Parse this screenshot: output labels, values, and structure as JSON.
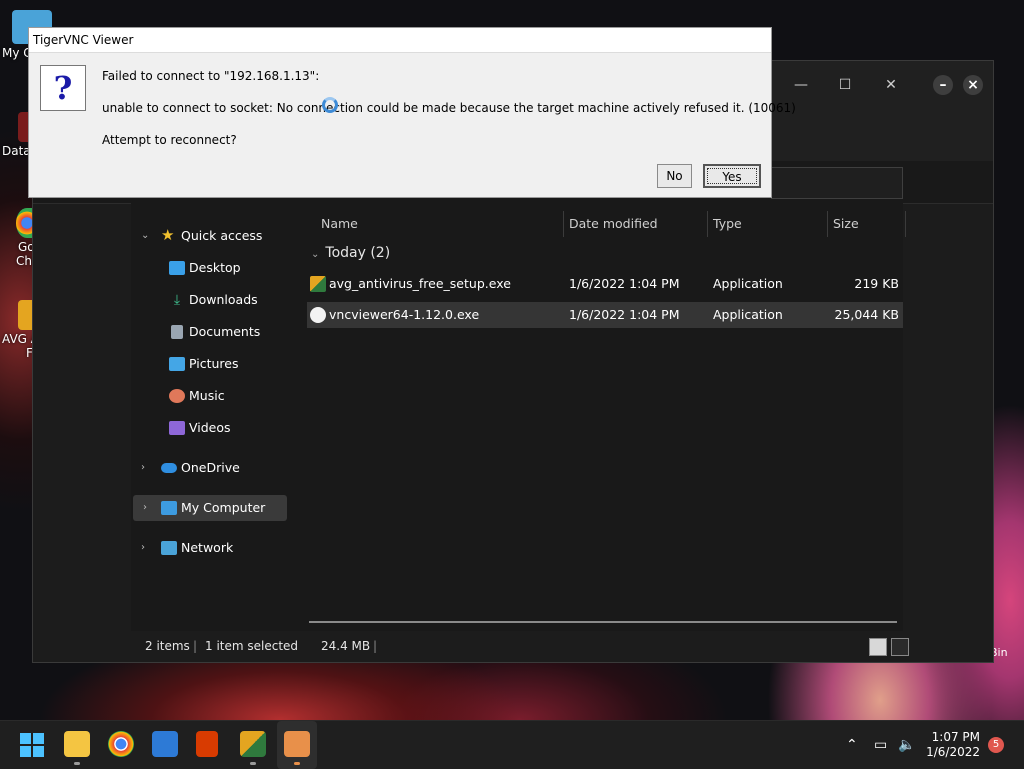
{
  "desktop": {
    "icons": [
      {
        "label": "My C"
      },
      {
        "label": "Data"
      },
      {
        "label": "Go"
      },
      {
        "label": "Chr"
      },
      {
        "label": "AVG A"
      },
      {
        "label": "F"
      }
    ],
    "recycle_label": "Bin"
  },
  "dialog": {
    "title": "TigerVNC Viewer",
    "line1": "Failed to connect to \"192.168.1.13\":",
    "line2": "unable to connect to socket: No connection could be made because the target machine actively refused it. (10061)",
    "line3": "Attempt to reconnect?",
    "no_label": "No",
    "yes_label": "Yes",
    "icon": "question-icon"
  },
  "explorer": {
    "window_controls": {
      "minimize": "—",
      "maximize": "☐",
      "close": "✕"
    },
    "nav": {
      "quick_access": "Quick access",
      "items": [
        {
          "label": "Desktop",
          "pinned": true,
          "icon": "desktop-icon",
          "color": "#3aa0e8"
        },
        {
          "label": "Downloads",
          "pinned": true,
          "icon": "download-icon",
          "color": "#3fbf8f"
        },
        {
          "label": "Documents",
          "pinned": true,
          "icon": "document-icon",
          "color": "#9aa6b2"
        },
        {
          "label": "Pictures",
          "pinned": true,
          "icon": "pictures-icon",
          "color": "#44a6e6"
        },
        {
          "label": "Music",
          "pinned": false,
          "icon": "music-icon",
          "color": "#e0785a"
        },
        {
          "label": "Videos",
          "pinned": false,
          "icon": "videos-icon",
          "color": "#8e67d8"
        }
      ],
      "onedrive": "OneDrive",
      "my_computer": "My Computer",
      "network": "Network"
    },
    "columns": {
      "name": "Name",
      "date": "Date modified",
      "type": "Type",
      "size": "Size"
    },
    "group": {
      "label": "Today (2)"
    },
    "files": [
      {
        "name": "avg_antivirus_free_setup.exe",
        "date": "1/6/2022 1:04 PM",
        "type": "Application",
        "size": "219 KB",
        "selected": false
      },
      {
        "name": "vncviewer64-1.12.0.exe",
        "date": "1/6/2022 1:04 PM",
        "type": "Application",
        "size": "25,044 KB",
        "selected": true
      }
    ],
    "status": {
      "items": "2 items",
      "selected": "1 item selected",
      "size": "24.4 MB"
    }
  },
  "taskbar": {
    "apps": [
      "start-icon",
      "file-explorer-icon",
      "chrome-icon",
      "store-icon",
      "office-icon",
      "avg-icon",
      "tigervnc-icon"
    ],
    "time": "1:07 PM",
    "date": "1/6/2022",
    "notifications": "5"
  },
  "colors": {
    "accent": "#3e8bd6",
    "selection": "#353535",
    "dialog_bg": "#f0f0f0"
  }
}
